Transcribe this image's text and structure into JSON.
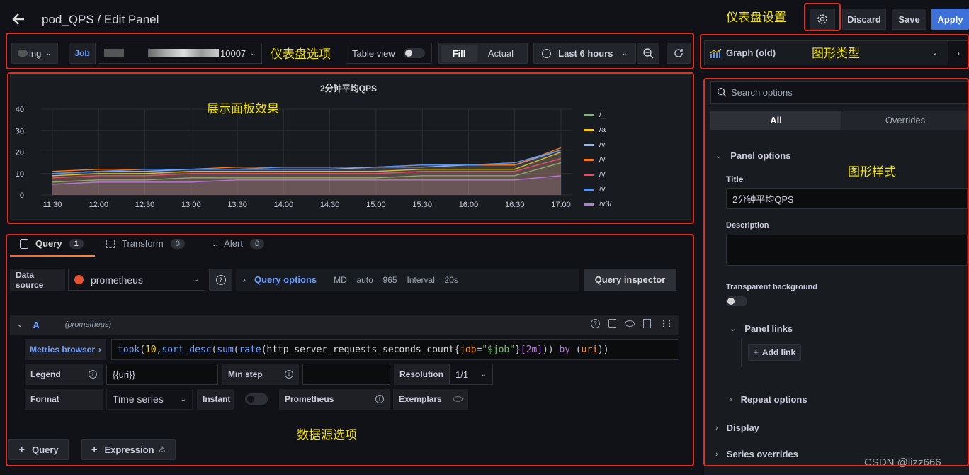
{
  "header": {
    "title": "pod_QPS / Edit Panel",
    "discard_label": "Discard",
    "save_label": "Save",
    "apply_label": "Apply"
  },
  "toolbar": {
    "datasource_var": "ing",
    "job_label": "Job",
    "job_value": "10007",
    "table_view_label": "Table view",
    "fill_label": "Fill",
    "actual_label": "Actual",
    "time_range": "Last 6 hours"
  },
  "viz_picker": {
    "label": "Graph (old)"
  },
  "chart": {
    "title": "2分钟平均QPS"
  },
  "chart_data": {
    "type": "line",
    "title": "2分钟平均QPS",
    "x": [
      "11:30",
      "12:00",
      "12:30",
      "13:00",
      "13:30",
      "14:00",
      "14:30",
      "15:00",
      "15:30",
      "16:00",
      "16:30",
      "17:00"
    ],
    "ylim": [
      0,
      40
    ],
    "yticks": [
      0,
      10,
      20,
      30,
      40
    ],
    "grid": true,
    "legend_position": "right",
    "series": [
      {
        "name": "/_",
        "color": "#73bf69",
        "values": [
          6,
          7,
          7,
          8,
          8,
          8,
          8,
          8,
          9,
          9,
          9,
          15
        ]
      },
      {
        "name": "/a",
        "color": "#f2cc0c",
        "values": [
          9,
          10,
          10,
          11,
          11,
          11,
          11,
          11,
          12,
          12,
          12,
          20
        ]
      },
      {
        "name": "/v",
        "color": "#8ab8ff",
        "values": [
          10,
          11,
          11,
          12,
          12,
          12,
          12,
          13,
          13,
          14,
          14,
          21
        ]
      },
      {
        "name": "/v",
        "color": "#ff780a",
        "values": [
          11,
          12,
          12,
          12,
          13,
          13,
          13,
          13,
          14,
          14,
          14,
          22
        ]
      },
      {
        "name": "/v",
        "color": "#f2495c",
        "values": [
          8,
          9,
          9,
          10,
          10,
          10,
          10,
          10,
          11,
          11,
          11,
          17
        ]
      },
      {
        "name": "/v",
        "color": "#5794f2",
        "values": [
          10,
          11,
          12,
          12,
          12,
          13,
          13,
          13,
          14,
          14,
          15,
          21
        ]
      },
      {
        "name": "/v3/",
        "color": "#b877d9",
        "values": [
          5,
          6,
          6,
          6,
          7,
          7,
          7,
          7,
          7,
          7,
          7,
          9
        ]
      }
    ]
  },
  "query_tabs": [
    {
      "label": "Query",
      "count": "1"
    },
    {
      "label": "Transform",
      "count": "0"
    },
    {
      "label": "Alert",
      "count": "0"
    }
  ],
  "query": {
    "datasource_label": "Data source",
    "datasource_value": "prometheus",
    "query_options_label": "Query options",
    "md_info": "MD = auto = 965",
    "interval_info": "Interval = 20s",
    "inspector_label": "Query inspector",
    "ref_id": "A",
    "ref_datasource": "(prometheus)",
    "metrics_browser_label": "Metrics browser",
    "expr_parts": {
      "fn1": "topk",
      "p1": "(",
      "num1": "10",
      "p2": ",",
      "fn2": "sort_desc",
      "p3": "(",
      "fn3": "sum",
      "p4": "(",
      "fn4": "rate",
      "p5": "(",
      "metric": "http_server_requests_seconds_count",
      "p6": "{",
      "labelkey": "job",
      "p7": "=",
      "labelval": "\"$job\"",
      "p8": "}",
      "range": "[2m]",
      "p9": "))",
      "kw": "by",
      "p10": "(",
      "grp": "uri",
      "p11": "))"
    },
    "legend_label": "Legend",
    "legend_value": "{{uri}}",
    "minstep_label": "Min step",
    "resolution_label": "Resolution",
    "resolution_value": "1/1",
    "format_label": "Format",
    "format_value": "Time series",
    "instant_label": "Instant",
    "prometheus_label": "Prometheus",
    "exemplars_label": "Exemplars",
    "add_query_label": "Query",
    "add_expression_label": "Expression"
  },
  "options_pane": {
    "search_placeholder": "Search options",
    "tab_all": "All",
    "tab_overrides": "Overrides",
    "panel_options_label": "Panel options",
    "title_label": "Title",
    "title_value": "2分钟平均QPS",
    "description_label": "Description",
    "transparent_label": "Transparent background",
    "panel_links_label": "Panel links",
    "add_link_label": "Add link",
    "repeat_options_label": "Repeat options",
    "display_label": "Display",
    "series_overrides_label": "Series overrides"
  },
  "annotations": {
    "dashboard_settings": "仪表盘设置",
    "dashboard_options": "仪表盘选项",
    "graph_type": "图形类型",
    "panel_effect": "展示面板效果",
    "graph_style": "图形样式",
    "datasource_options": "数据源选项"
  },
  "watermark": "CSDN @lizz666",
  "colors": {
    "accent_blue": "#3d71d9",
    "annotation_yellow": "#f5e400",
    "annotation_red": "#e02f20",
    "background": "#111217",
    "panel": "#181b1f"
  }
}
